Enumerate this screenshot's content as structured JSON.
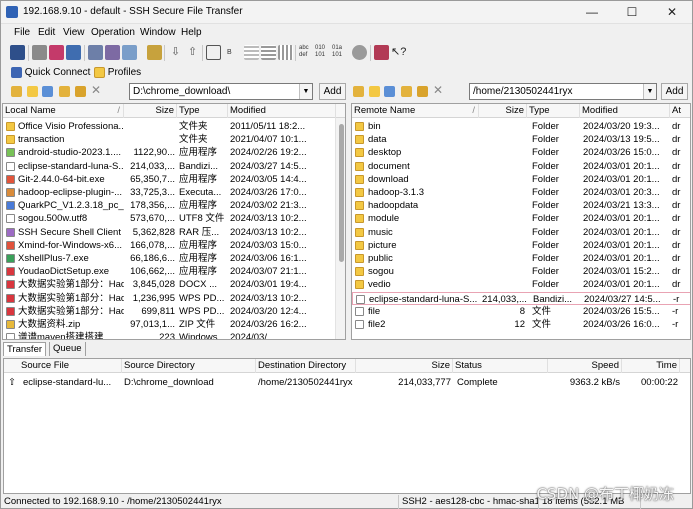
{
  "window": {
    "title": "192.168.9.10 - default - SSH Secure File Transfer",
    "minimize": "—",
    "maximize": "☐",
    "close": "✕"
  },
  "menu": [
    "File",
    "Edit",
    "View",
    "Operation",
    "Window",
    "Help"
  ],
  "quickbar": {
    "quick_connect": "Quick Connect",
    "profiles": "Profiles"
  },
  "local": {
    "path": "D:\\chrome_download\\",
    "add": "Add",
    "headers": {
      "name": "Local Name",
      "sort": "/",
      "size": "Size",
      "type": "Type",
      "modified": "Modified"
    },
    "rows": [
      {
        "name": "Office Visio Professiona...",
        "size": "",
        "type": "文件夹",
        "modified": "2011/05/11 18:2...",
        "icon": "folder",
        "color": "#f3c843"
      },
      {
        "name": "transaction",
        "size": "",
        "type": "文件夹",
        "modified": "2021/04/07 10:1...",
        "icon": "folder",
        "color": "#f3c843"
      },
      {
        "name": "android-studio-2023.1....",
        "size": "1122,90...",
        "type": "应用程序",
        "modified": "2024/02/26 19:2...",
        "icon": "android-icon",
        "color": "#78c257"
      },
      {
        "name": "eclipse-standard-luna-S...",
        "size": "214,033,...",
        "type": "Bandizi...",
        "modified": "2024/03/27 14:5...",
        "icon": "file-icon",
        "color": "#ffffff"
      },
      {
        "name": "Git-2.44.0-64-bit.exe",
        "size": "65,350,7...",
        "type": "应用程序",
        "modified": "2024/03/05 14:4...",
        "icon": "git-icon",
        "color": "#e2553b"
      },
      {
        "name": "hadoop-eclipse-plugin-...",
        "size": "33,725,3...",
        "type": "Executa...",
        "modified": "2024/03/26 17:0...",
        "icon": "jar-icon",
        "color": "#d98b3a"
      },
      {
        "name": "QuarkPC_V1.2.3.18_pc_...",
        "size": "178,356,...",
        "type": "应用程序",
        "modified": "2024/03/02 21:3...",
        "icon": "quark-icon",
        "color": "#4a7bd8"
      },
      {
        "name": "sogou.500w.utf8",
        "size": "573,670,...",
        "type": "UTF8 文件",
        "modified": "2024/03/13 10:2...",
        "icon": "file-icon",
        "color": "#ffffff"
      },
      {
        "name": "SSH Secure Shell Client ...",
        "size": "5,362,828",
        "type": "RAR 压...",
        "modified": "2024/03/13 10:2...",
        "icon": "archive-icon",
        "color": "#9c6bc4"
      },
      {
        "name": "Xmind-for-Windows-x6...",
        "size": "166,078,...",
        "type": "应用程序",
        "modified": "2024/03/03 15:0...",
        "icon": "xmind-icon",
        "color": "#e0523c"
      },
      {
        "name": "XshellPlus-7.exe",
        "size": "66,186,6...",
        "type": "应用程序",
        "modified": "2024/03/06 16:1...",
        "icon": "xshell-icon",
        "color": "#3aa05a"
      },
      {
        "name": "YoudaoDictSetup.exe",
        "size": "106,662,...",
        "type": "应用程序",
        "modified": "2024/03/07 21:1...",
        "icon": "youdao-icon",
        "color": "#d9363e"
      },
      {
        "name": "大数据实验第1部分：Had...",
        "size": "3,845,028",
        "type": "DOCX ...",
        "modified": "2024/03/01 19:4...",
        "icon": "wps-icon",
        "color": "#d9363e"
      },
      {
        "name": "大数据实验第1部分：Had...",
        "size": "1,236,995",
        "type": "WPS PD...",
        "modified": "2024/03/13 10:2...",
        "icon": "wps-icon",
        "color": "#d9363e"
      },
      {
        "name": "大数据实验第1部分：Had...",
        "size": "699,811",
        "type": "WPS PD...",
        "modified": "2024/03/20 12:4...",
        "icon": "wps-icon",
        "color": "#d9363e"
      },
      {
        "name": "大数据资料.zip",
        "size": "97,013,1...",
        "type": "ZIP 文件",
        "modified": "2024/03/26 16:2...",
        "icon": "zip-icon",
        "color": "#e7b93b"
      },
      {
        "name": "谱谱maven搭建搭建...",
        "size": "223",
        "type": "Windows...",
        "modified": "2024/03/...",
        "icon": "file-icon",
        "color": "#ffffff"
      }
    ]
  },
  "remote": {
    "path": "/home/2130502441ryx",
    "add": "Add",
    "headers": {
      "name": "Remote Name",
      "sort": "/",
      "size": "Size",
      "type": "Type",
      "modified": "Modified",
      "attr": "At"
    },
    "rows": [
      {
        "name": "bin",
        "size": "",
        "type": "Folder",
        "modified": "2024/03/20 19:3...",
        "attr": "dr",
        "icon": "folder"
      },
      {
        "name": "data",
        "size": "",
        "type": "Folder",
        "modified": "2024/03/13 19:5...",
        "attr": "dr",
        "icon": "folder"
      },
      {
        "name": "desktop",
        "size": "",
        "type": "Folder",
        "modified": "2024/03/26 15:0...",
        "attr": "dr",
        "icon": "folder"
      },
      {
        "name": "document",
        "size": "",
        "type": "Folder",
        "modified": "2024/03/01 20:1...",
        "attr": "dr",
        "icon": "folder"
      },
      {
        "name": "download",
        "size": "",
        "type": "Folder",
        "modified": "2024/03/01 20:1...",
        "attr": "dr",
        "icon": "folder"
      },
      {
        "name": "hadoop-3.1.3",
        "size": "",
        "type": "Folder",
        "modified": "2024/03/01 20:3...",
        "attr": "dr",
        "icon": "folder"
      },
      {
        "name": "hadoopdata",
        "size": "",
        "type": "Folder",
        "modified": "2024/03/21 13:3...",
        "attr": "dr",
        "icon": "folder"
      },
      {
        "name": "module",
        "size": "",
        "type": "Folder",
        "modified": "2024/03/01 20:1...",
        "attr": "dr",
        "icon": "folder"
      },
      {
        "name": "music",
        "size": "",
        "type": "Folder",
        "modified": "2024/03/01 20:1...",
        "attr": "dr",
        "icon": "folder"
      },
      {
        "name": "picture",
        "size": "",
        "type": "Folder",
        "modified": "2024/03/01 20:1...",
        "attr": "dr",
        "icon": "folder"
      },
      {
        "name": "public",
        "size": "",
        "type": "Folder",
        "modified": "2024/03/01 20:1...",
        "attr": "dr",
        "icon": "folder"
      },
      {
        "name": "sogou",
        "size": "",
        "type": "Folder",
        "modified": "2024/03/01 15:2...",
        "attr": "dr",
        "icon": "folder"
      },
      {
        "name": "vedio",
        "size": "",
        "type": "Folder",
        "modified": "2024/03/01 20:1...",
        "attr": "dr",
        "icon": "folder"
      },
      {
        "name": "eclipse-standard-luna-S...",
        "size": "214,033,...",
        "type": "Bandizi...",
        "modified": "2024/03/27 14:5...",
        "attr": "-r",
        "icon": "file-icon",
        "selected": true
      },
      {
        "name": "file",
        "size": "8",
        "type": "文件",
        "modified": "2024/03/26 15:5...",
        "attr": "-r",
        "icon": "file-icon"
      },
      {
        "name": "file2",
        "size": "12",
        "type": "文件",
        "modified": "2024/03/26 16:0...",
        "attr": "-r",
        "icon": "file-icon"
      }
    ]
  },
  "tabs": [
    "Transfer",
    "Queue"
  ],
  "transfers": {
    "headers": {
      "source_file": "Source File",
      "source_dir": "Source Directory",
      "dest_dir": "Destination Directory",
      "size": "Size",
      "status": "Status",
      "speed": "Speed",
      "time": "Time"
    },
    "rows": [
      {
        "arrow": "⇧",
        "source_file": "eclipse-standard-lu...",
        "source_dir": "D:\\chrome_download",
        "dest_dir": "/home/2130502441ryx",
        "size": "214,033,777",
        "status": "Complete",
        "speed": "9363.2 kB/s",
        "time": "00:00:22"
      }
    ]
  },
  "status": {
    "connection": "Connected to 192.168.9.10 - /home/2130502441ryx",
    "protocol": "SSH2 - aes128-cbc - hmac-sha1",
    "items": "18 items (552.1 MB"
  },
  "watermark": "CSDN @布丁椰奶冻"
}
